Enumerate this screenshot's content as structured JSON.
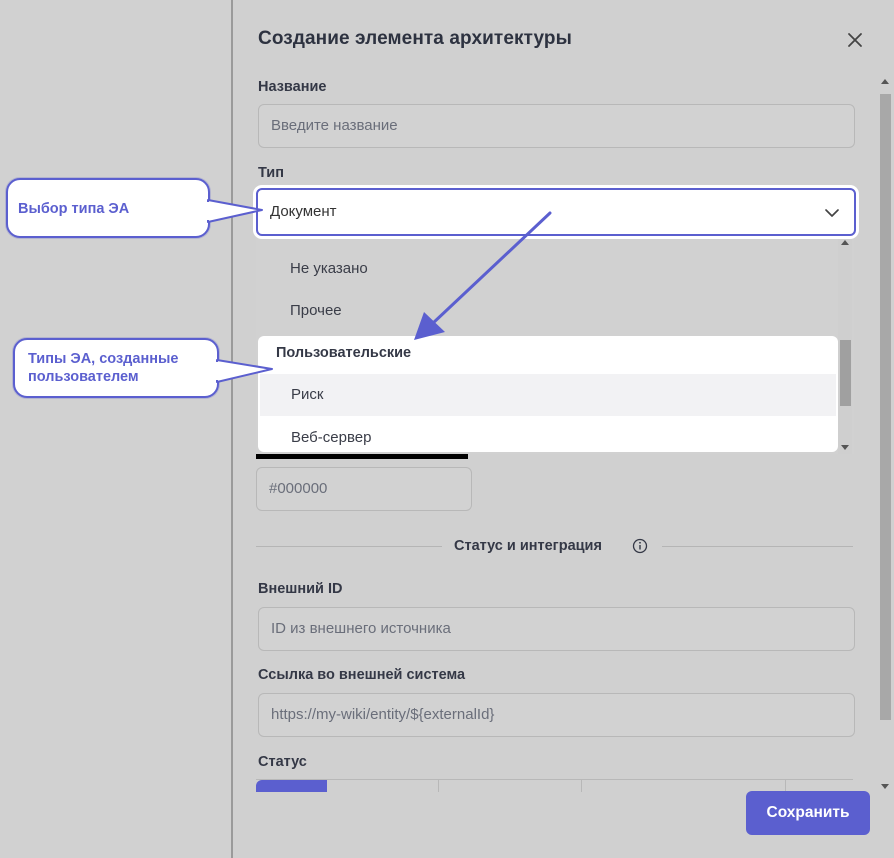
{
  "modal": {
    "title": "Создание элемента архитектуры",
    "close_icon": "close-icon"
  },
  "form": {
    "name": {
      "label": "Название",
      "placeholder": "Введите название",
      "value": ""
    },
    "type": {
      "label": "Тип",
      "selected": "Документ",
      "icon": "chevron-down-icon"
    },
    "dropdown": {
      "items_top": [
        "Не указано",
        "Прочее"
      ],
      "group": {
        "title": "Пользовательские",
        "items": [
          "Риск",
          "Веб-сервер"
        ]
      }
    },
    "color": {
      "value": "#000000",
      "swatch": "#000000"
    },
    "section": {
      "title": "Статус и интеграция",
      "icon": "info-icon"
    },
    "external_id": {
      "label": "Внешний ID",
      "placeholder": "ID из внешнего источника",
      "value": ""
    },
    "external_link": {
      "label": "Ссылка во внешней система",
      "placeholder": "https://my-wiki/entity/${externalId}",
      "value": ""
    },
    "status": {
      "label": "Статус"
    }
  },
  "footer": {
    "save_label": "Сохранить"
  },
  "annotations": {
    "type_callout": "Выбор типа ЭА",
    "user_types_callout": "Типы ЭА, созданные пользователем"
  },
  "colors": {
    "accent": "#5b5fcf",
    "background": "#d0d0d0",
    "callout_text": "#5b5fcf"
  }
}
